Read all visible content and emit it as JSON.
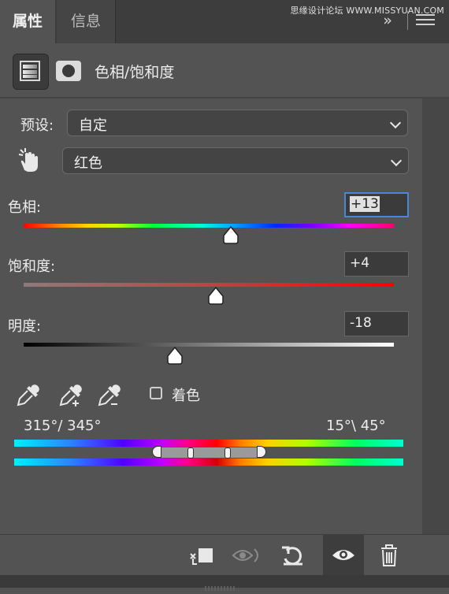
{
  "tabs": [
    {
      "label": "属性",
      "active": true
    },
    {
      "label": "信息",
      "active": false
    }
  ],
  "watermark": "思缘设计论坛 WWW.MISSYUAN.COM",
  "header": {
    "title": "色相/饱和度",
    "adjustment_icon": "hue-saturation-icon",
    "mask_icon": "layer-mask-icon"
  },
  "preset": {
    "label": "预设:",
    "value": "自定"
  },
  "channel": {
    "value": "红色"
  },
  "sliders": {
    "hue": {
      "label": "色相:",
      "value": "+13"
    },
    "saturation": {
      "label": "饱和度:",
      "value": "+4"
    },
    "lightness": {
      "label": "明度:",
      "value": "-18"
    }
  },
  "colorize": {
    "label": "着色",
    "checked": false
  },
  "range": {
    "left": "315°/ 345°",
    "right": "15°\\ 45°"
  },
  "toolbar": {
    "icons": [
      "clip-to-layer-icon",
      "view-previous-state-icon",
      "reset-icon",
      "visibility-eye-icon",
      "trash-icon"
    ]
  },
  "colors": {
    "panel": "#535353",
    "tabbar": "#3d3d3d",
    "focus": "#4a86d8"
  }
}
